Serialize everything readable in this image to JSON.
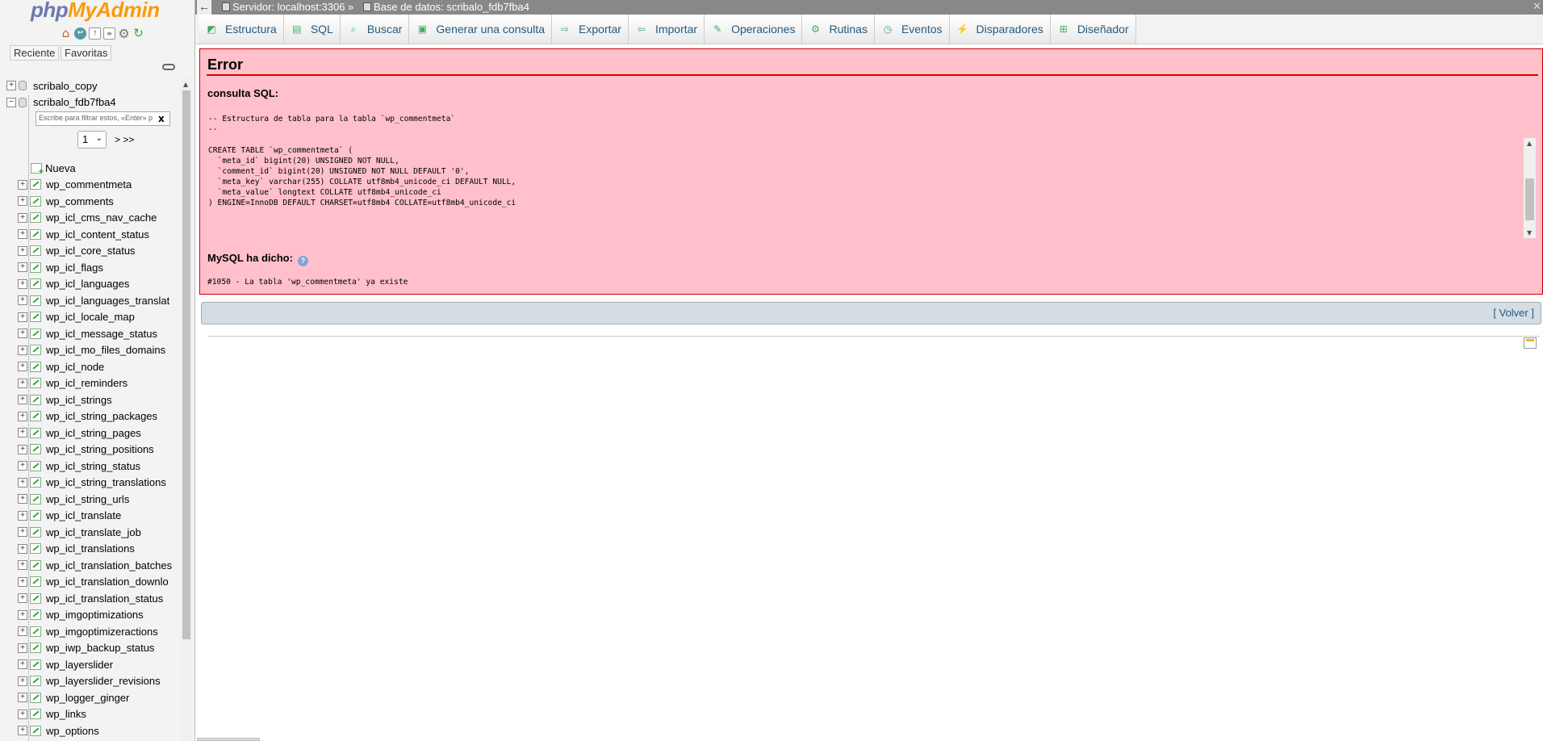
{
  "logo": {
    "part1": "php",
    "part2": "MyAdmin"
  },
  "nav": {
    "tabs": [
      "Reciente",
      "Favoritas"
    ],
    "databases": [
      "scribalo_copy",
      "scribalo_fdb7fba4"
    ],
    "filter_placeholder": "Escribe para filtrar estos, «Enter» p",
    "filter_clear": "x",
    "page_select_value": "1",
    "page_next": "> >>",
    "new_item": "Nueva",
    "tables": [
      "wp_commentmeta",
      "wp_comments",
      "wp_icl_cms_nav_cache",
      "wp_icl_content_status",
      "wp_icl_core_status",
      "wp_icl_flags",
      "wp_icl_languages",
      "wp_icl_languages_translat",
      "wp_icl_locale_map",
      "wp_icl_message_status",
      "wp_icl_mo_files_domains",
      "wp_icl_node",
      "wp_icl_reminders",
      "wp_icl_strings",
      "wp_icl_string_packages",
      "wp_icl_string_pages",
      "wp_icl_string_positions",
      "wp_icl_string_status",
      "wp_icl_string_translations",
      "wp_icl_string_urls",
      "wp_icl_translate",
      "wp_icl_translate_job",
      "wp_icl_translations",
      "wp_icl_translation_batches",
      "wp_icl_translation_downlo",
      "wp_icl_translation_status",
      "wp_imgoptimizations",
      "wp_imgoptimizeractions",
      "wp_iwp_backup_status",
      "wp_layerslider",
      "wp_layerslider_revisions",
      "wp_logger_ginger",
      "wp_links",
      "wp_options"
    ]
  },
  "topbar": {
    "back": "←",
    "server": "Servidor: localhost:3306 »",
    "database": "Base de datos: scribalo_fdb7fba4",
    "close": "✕"
  },
  "tabs": [
    {
      "label": "Estructura",
      "icon": "structure-icon"
    },
    {
      "label": "SQL",
      "icon": "sql-icon"
    },
    {
      "label": "Buscar",
      "icon": "search-icon"
    },
    {
      "label": "Generar una consulta",
      "icon": "query-icon"
    },
    {
      "label": "Exportar",
      "icon": "export-icon"
    },
    {
      "label": "Importar",
      "icon": "import-icon"
    },
    {
      "label": "Operaciones",
      "icon": "wrench-icon"
    },
    {
      "label": "Rutinas",
      "icon": "routines-icon"
    },
    {
      "label": "Eventos",
      "icon": "events-icon"
    },
    {
      "label": "Disparadores",
      "icon": "triggers-icon"
    },
    {
      "label": "Diseñador",
      "icon": "designer-icon"
    }
  ],
  "error": {
    "title": "Error",
    "sql_label": "consulta SQL:",
    "sql_lines": [
      "-- Estructura de tabla para la tabla `wp_commentmeta`",
      "--",
      "",
      "CREATE TABLE `wp_commentmeta` (",
      "  `meta_id` bigint(20) UNSIGNED NOT NULL,",
      "  `comment_id` bigint(20) UNSIGNED NOT NULL DEFAULT '0',",
      "  `meta_key` varchar(255) COLLATE utf8mb4_unicode_ci DEFAULT NULL,",
      "  `meta_value` longtext COLLATE utf8mb4_unicode_ci",
      ") ENGINE=InnoDB DEFAULT CHARSET=utf8mb4 COLLATE=utf8mb4_unicode_ci"
    ],
    "mysql_said": "MySQL ha dicho:",
    "message": "#1050 - La tabla  'wp_commentmeta' ya existe"
  },
  "volver": {
    "open": "[",
    "link": "Volver",
    "close": "]"
  },
  "colors": {
    "error_bg": "#ffc0cb",
    "error_border": "#cc0000",
    "link": "#235a81"
  }
}
